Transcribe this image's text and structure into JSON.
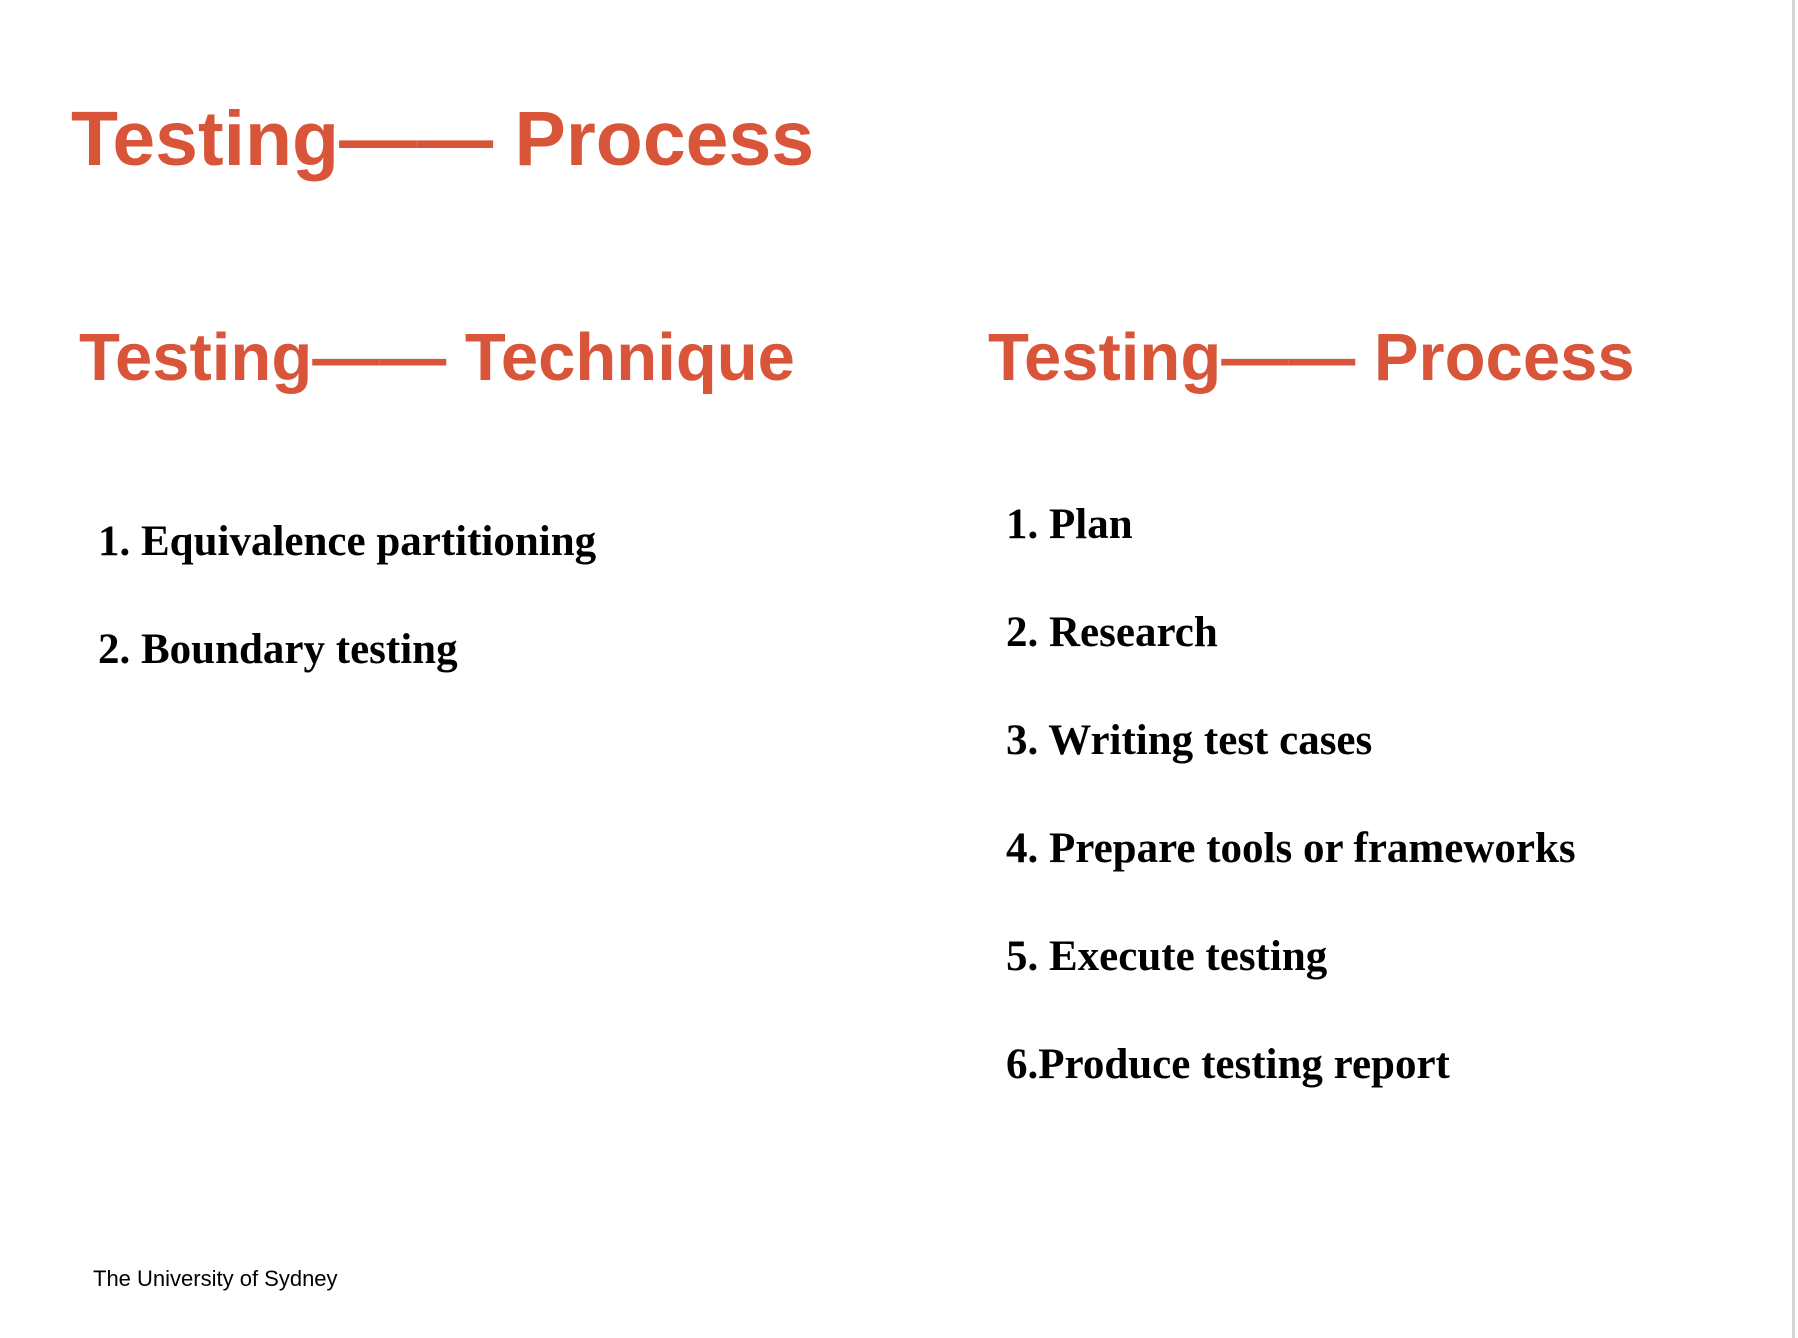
{
  "slide": {
    "title": "Testing—— Process",
    "columns": [
      {
        "heading": "Testing—— Technique",
        "items": [
          "1. Equivalence partitioning",
          "2. Boundary testing"
        ]
      },
      {
        "heading": "Testing—— Process",
        "items": [
          "1. Plan",
          "2. Research",
          "3. Writing test cases",
          "4. Prepare tools or frameworks",
          "5. Execute testing",
          "6.Produce testing report"
        ]
      }
    ],
    "footer": "The University of Sydney"
  },
  "colors": {
    "accent": "#d9553a",
    "text": "#000000",
    "background": "#ffffff"
  }
}
